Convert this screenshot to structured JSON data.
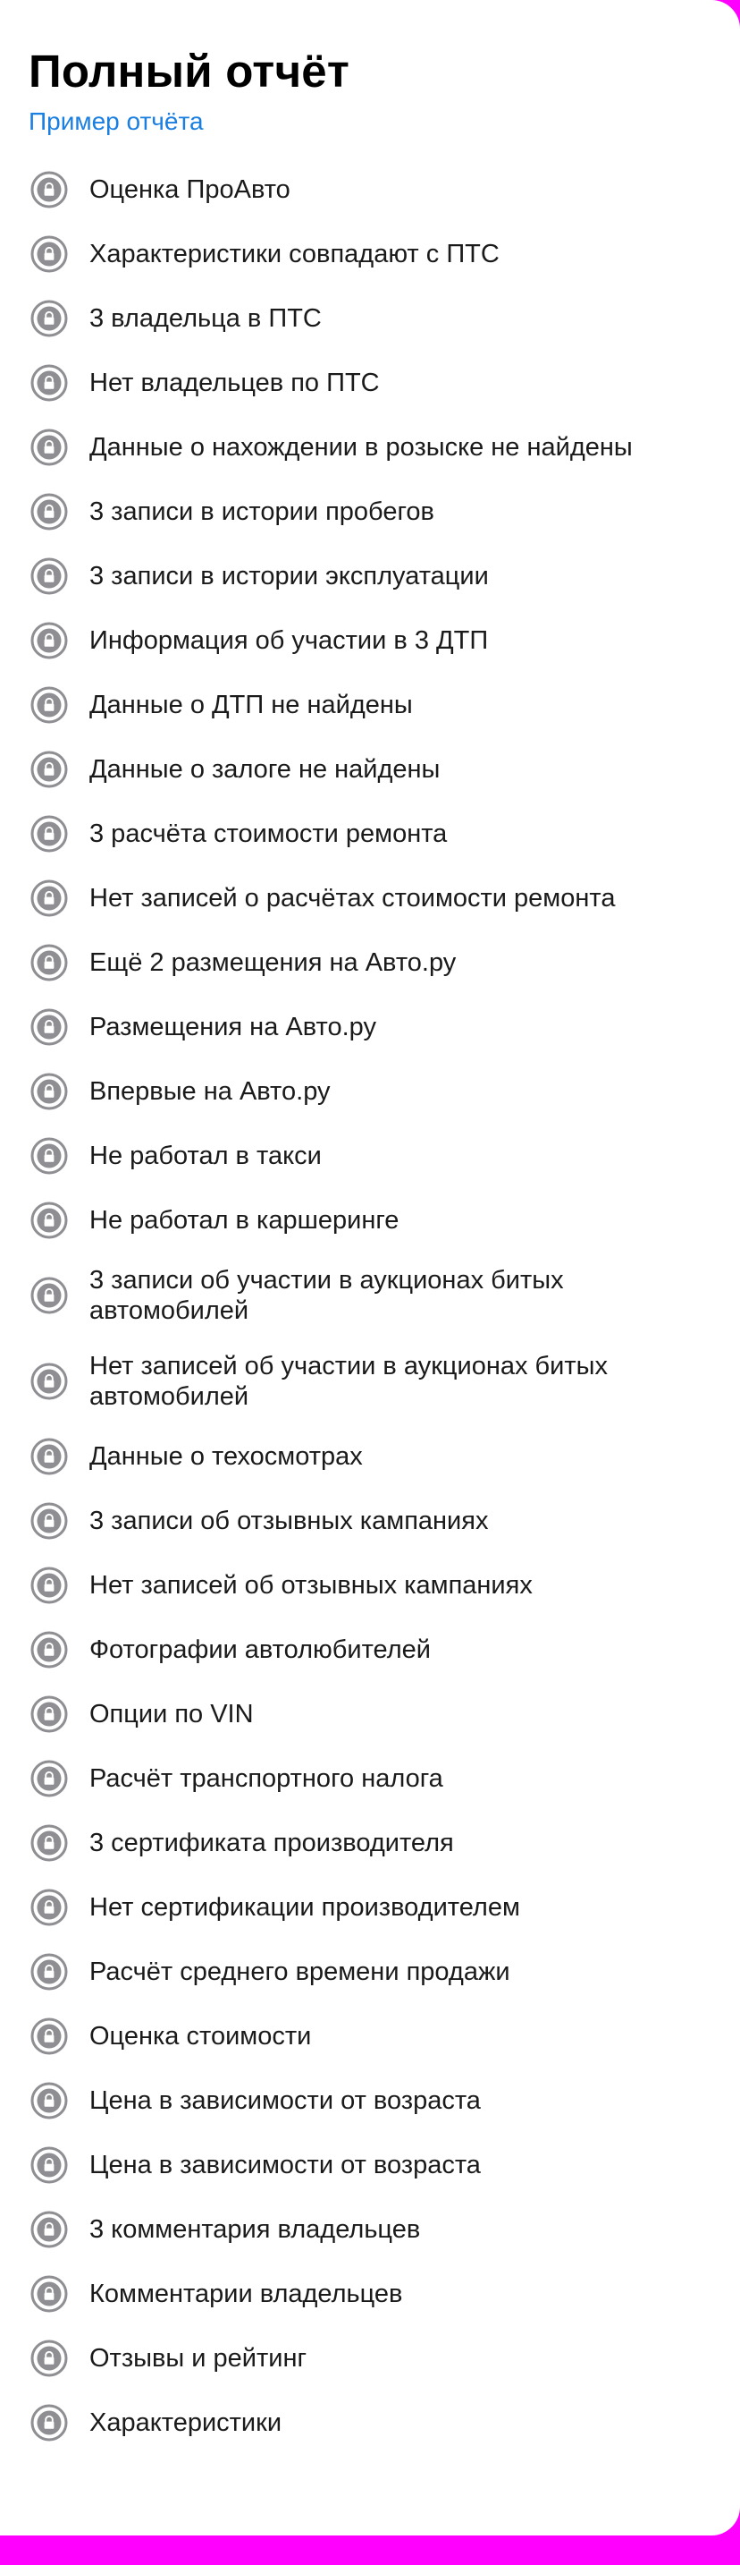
{
  "report": {
    "title": "Полный отчёт",
    "sample_link": "Пример отчёта"
  },
  "icons": {
    "item_icon": "lock-icon",
    "icon_color": "#8e8e93"
  },
  "colors": {
    "background": "#ff00ff",
    "card": "#ffffff",
    "link": "#1a7fe0",
    "text": "#1a1a1a"
  },
  "features": [
    {
      "label": "Оценка ПроАвто"
    },
    {
      "label": "Характеристики совпадают с ПТС"
    },
    {
      "label": "3 владельца в ПТС"
    },
    {
      "label": "Нет владельцев по ПТС"
    },
    {
      "label": "Данные о нахождении в розыске не найдены"
    },
    {
      "label": "3 записи в истории пробегов"
    },
    {
      "label": "3 записи в истории эксплуатации"
    },
    {
      "label": "Информация об участии в 3 ДТП"
    },
    {
      "label": "Данные о ДТП не найдены"
    },
    {
      "label": "Данные о залоге не найдены"
    },
    {
      "label": "3 расчёта стоимости ремонта"
    },
    {
      "label": "Нет записей о расчётах стоимости ремонта"
    },
    {
      "label": "Ещё 2 размещения на Авто.ру"
    },
    {
      "label": "Размещения на Авто.ру"
    },
    {
      "label": "Впервые на Авто.ру"
    },
    {
      "label": "Не работал в такси"
    },
    {
      "label": "Не работал в каршеринге"
    },
    {
      "label": "3 записи об участии в аукционах битых автомобилей"
    },
    {
      "label": "Нет записей об участии в аукционах битых автомобилей"
    },
    {
      "label": "Данные о техосмотрах"
    },
    {
      "label": "3 записи об отзывных кампаниях"
    },
    {
      "label": "Нет записей об отзывных кампаниях"
    },
    {
      "label": "Фотографии автолюбителей"
    },
    {
      "label": "Опции по VIN"
    },
    {
      "label": "Расчёт транспортного налога"
    },
    {
      "label": "3 сертификата производителя"
    },
    {
      "label": "Нет сертификации производителем"
    },
    {
      "label": "Расчёт среднего времени продажи"
    },
    {
      "label": "Оценка стоимости"
    },
    {
      "label": "Цена в зависимости от возраста"
    },
    {
      "label": "Цена в зависимости от возраста"
    },
    {
      "label": "3 комментария владельцев"
    },
    {
      "label": "Комментарии владельцев"
    },
    {
      "label": "Отзывы и рейтинг"
    },
    {
      "label": "Характеристики"
    }
  ]
}
